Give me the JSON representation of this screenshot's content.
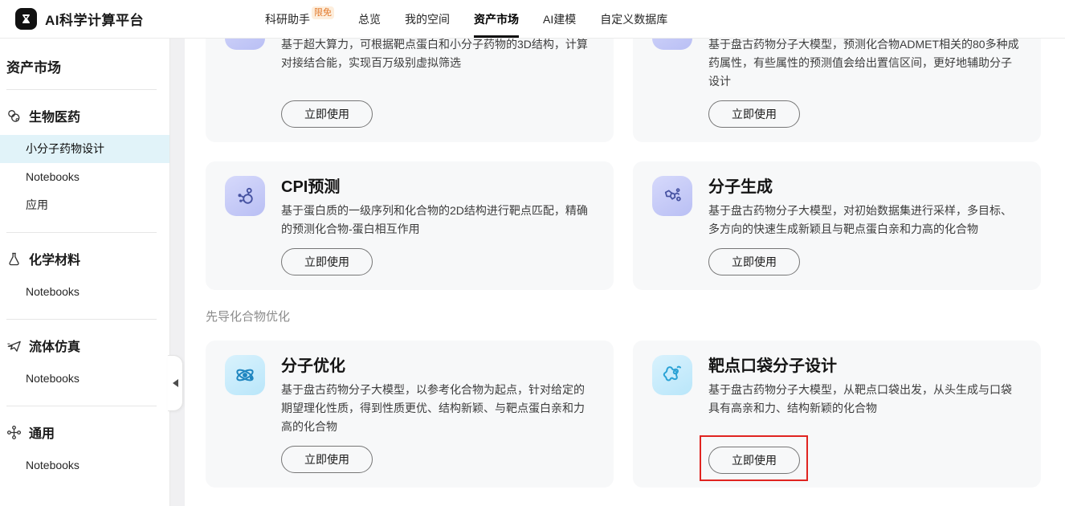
{
  "colors": {
    "annotation_red": "#e02420",
    "active_tab_underline": "#111111",
    "badge_orange_text": "#e2782a",
    "badge_orange_bg": "#fdeedd",
    "sidebar_active_bg": "#e1f3f9",
    "card_bg": "#f7f8f9",
    "icon_purple_bg": "#c5caf6",
    "icon_purple_glyph": "#4652a1",
    "icon_blue_bg": "#c9ebfa",
    "icon_blue_glyph": "#1f86c0"
  },
  "header": {
    "logo_title": "AI科学计算平台",
    "nav": [
      {
        "label": "科研助手",
        "badge": "限免"
      },
      {
        "label": "总览"
      },
      {
        "label": "我的空间"
      },
      {
        "label": "资产市场",
        "active": true
      },
      {
        "label": "AI建模"
      },
      {
        "label": "自定义数据库"
      }
    ]
  },
  "sidebar": {
    "title": "资产市场",
    "sections": [
      {
        "label": "生物医药",
        "items": [
          {
            "label": "小分子药物设计",
            "active": true
          },
          {
            "label": "Notebooks"
          },
          {
            "label": "应用"
          }
        ]
      },
      {
        "label": "化学材料",
        "items": [
          {
            "label": "Notebooks"
          }
        ]
      },
      {
        "label": "流体仿真",
        "items": [
          {
            "label": "Notebooks"
          }
        ]
      },
      {
        "label": "通用",
        "items": [
          {
            "label": "Notebooks"
          }
        ]
      }
    ]
  },
  "main": {
    "section_label": "先导化合物优化",
    "cards": [
      {
        "title": "",
        "description": "基于超大算力，可根据靶点蛋白和小分子药物的3D结构，计算对接结合能，实现百万级别虚拟筛选",
        "button": "立即使用"
      },
      {
        "title": "",
        "description": "基于盘古药物分子大模型，预测化合物ADMET相关的80多种成药属性，有些属性的预测值会给出置信区间，更好地辅助分子设计",
        "button": "立即使用"
      },
      {
        "title": "CPI预测",
        "description": "基于蛋白质的一级序列和化合物的2D结构进行靶点匹配，精确的预测化合物-蛋白相互作用",
        "button": "立即使用"
      },
      {
        "title": "分子生成",
        "description": "基于盘古药物分子大模型，对初始数据集进行采样，多目标、多方向的快速生成新颖且与靶点蛋白亲和力高的化合物",
        "button": "立即使用"
      },
      {
        "title": "分子优化",
        "description": "基于盘古药物分子大模型，以参考化合物为起点，针对给定的期望理化性质，得到性质更优、结构新颖、与靶点蛋白亲和力高的化合物",
        "button": "立即使用"
      },
      {
        "title": "靶点口袋分子设计",
        "description": "基于盘古药物分子大模型，从靶点口袋出发，从头生成与口袋具有高亲和力、结构新颖的化合物",
        "button": "立即使用",
        "highlighted": true
      }
    ]
  }
}
